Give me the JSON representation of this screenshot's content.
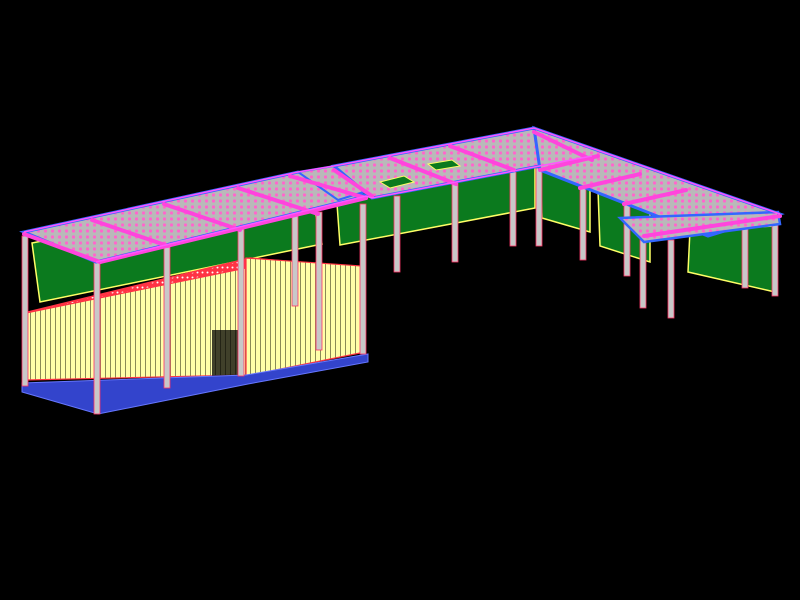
{
  "scene": {
    "background": "#000000",
    "colors": {
      "roof_fill": "#b9b9b9",
      "roof_dot": "#ff66cc",
      "roof_edge_blue": "#3366ff",
      "roof_edge_magenta": "#ff55ff",
      "beam_magenta": "#ff44dd",
      "column": "#c8c8c8",
      "column_edge": "#ff3366",
      "wall_green": "#0b7a1e",
      "wall_green_edge": "#ffff66",
      "wall_yellow": "#ffffa8",
      "wall_yellow_line": "#8a8a55",
      "floor_red": "#ff3344",
      "base_blue": "#3344cc"
    }
  }
}
